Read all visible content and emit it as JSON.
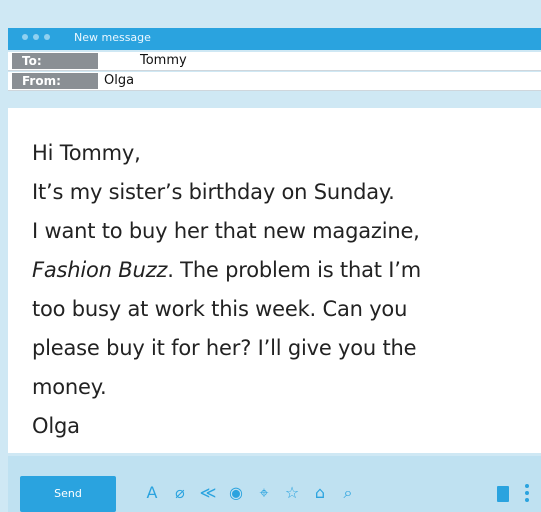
{
  "window": {
    "title": "New message"
  },
  "header": {
    "to_label": "To:",
    "to_value": "Tommy",
    "from_label": "From:",
    "from_value": "Olga"
  },
  "message": {
    "greeting": "Hi Tommy,",
    "line1": "It’s my sister’s birthday on Sunday.",
    "line2": "I want to buy her that new magazine,",
    "line3_italic": "Fashion Buzz",
    "line3_rest": ". The problem is that I’m",
    "line4": "too busy at work this week. Can you",
    "line5": "please buy it for her? I’ll give you the",
    "line6": "money.",
    "signature": "Olga"
  },
  "toolbar": {
    "send_label": "Send",
    "tools": [
      "text-format-icon",
      "attachment-icon",
      "share-icon",
      "camera-icon",
      "location-icon",
      "star-icon",
      "home-icon",
      "search-icon"
    ],
    "tool_glyphs": [
      "A",
      "⌀",
      "≪",
      "◉",
      "⌖",
      "☆",
      "⌂",
      "⌕"
    ]
  },
  "colors": {
    "accent": "#2aa3df",
    "label_bg": "#8a8f94",
    "background": "#cfe8f4"
  }
}
